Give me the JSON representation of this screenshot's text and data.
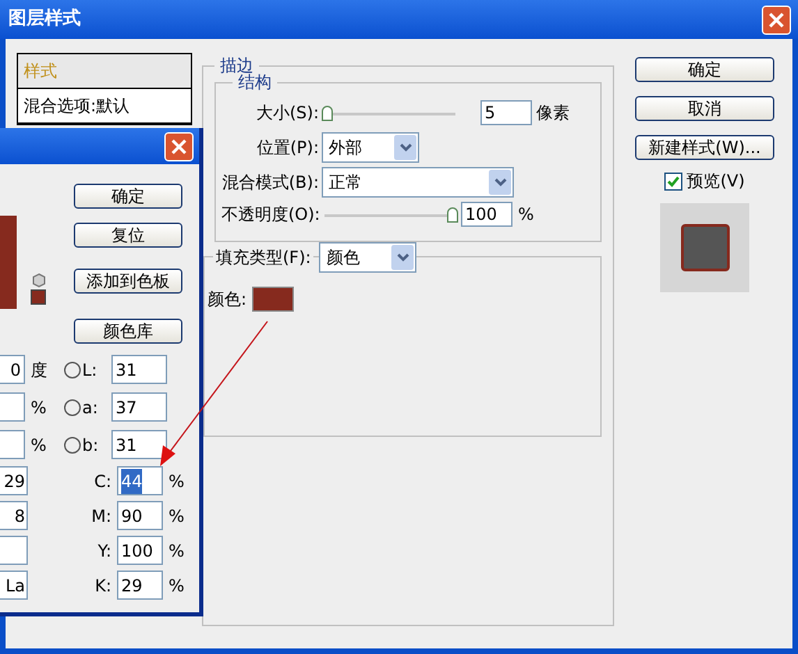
{
  "window": {
    "title": "图层样式"
  },
  "styles_list": [
    {
      "label": "样式",
      "selected": true
    },
    {
      "label": "混合选项:默认",
      "selected": false
    }
  ],
  "stroke": {
    "title": "描边",
    "structure": {
      "title": "结构",
      "size": {
        "label": "大小(S):",
        "level": 0,
        "value": "5",
        "unit": "像素"
      },
      "position": {
        "label": "位置(P):",
        "value": "外部"
      },
      "blend_mode": {
        "label": "混合模式(B):",
        "value": "正常"
      },
      "opacity": {
        "label": "不透明度(O):",
        "level": 1,
        "value": "100",
        "unit": "%"
      }
    },
    "fill_type": {
      "label": "填充类型(F):",
      "value": "颜色"
    },
    "color": {
      "label": "颜色:",
      "color": "#862a1e"
    }
  },
  "buttons": [
    "确定",
    "取消",
    "新建样式(W)..."
  ],
  "preview": {
    "label": "预览(V)",
    "checked": true
  },
  "color_picker": {
    "buttons": [
      "确定",
      "复位",
      "添加到色板",
      "颜色库"
    ],
    "hsb_fields": [
      {
        "value": "0",
        "unit": "度"
      },
      {
        "unit": "%"
      },
      {
        "unit": "%"
      }
    ],
    "lab_fields": [
      {
        "label": "L:",
        "value": "31",
        "selected": false
      },
      {
        "label": "a:",
        "value": "37",
        "selected": false
      },
      {
        "label": "b:",
        "value": "31",
        "selected": false
      }
    ],
    "cmyk_fields": [
      {
        "label": "C:",
        "value": "44",
        "unit": "%",
        "text_selected": true,
        "left_value": "29"
      },
      {
        "label": "M:",
        "value": "90",
        "unit": "%",
        "text_selected": false,
        "left_value": "8"
      },
      {
        "label": "Y:",
        "value": "100",
        "unit": "%",
        "text_selected": false
      },
      {
        "label": "K:",
        "value": "29",
        "unit": "%",
        "text_selected": false,
        "left_value": "La"
      }
    ]
  }
}
